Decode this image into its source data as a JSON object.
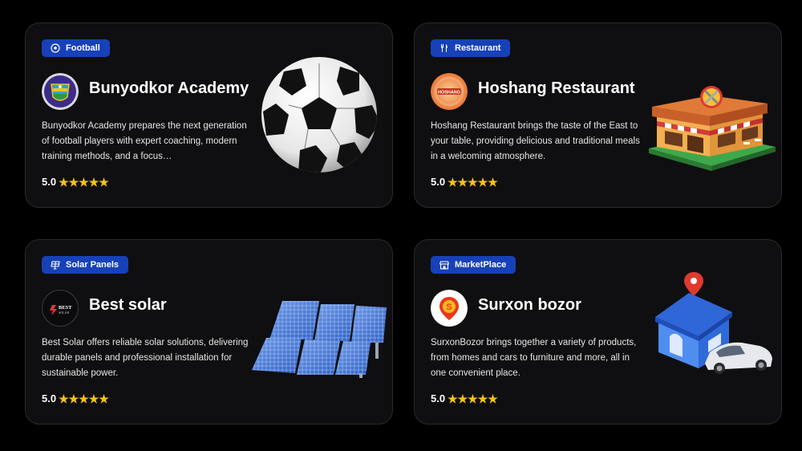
{
  "cards": [
    {
      "category": "Football",
      "category_icon": "soccer-ball-icon",
      "title": "Bunyodkor Academy",
      "description": "Bunyodkor Academy prepares the next generation of football players with expert coaching, modern training methods, and a focus…",
      "rating": "5.0",
      "stars": "★★★★★",
      "illustration": "soccer-ball"
    },
    {
      "category": "Restaurant",
      "category_icon": "fork-knife-icon",
      "title": "Hoshang Restaurant",
      "description": "Hoshang Restaurant brings the taste of the East to your table, providing delicious and traditional meals in a welcoming atmosphere.",
      "rating": "5.0",
      "stars": "★★★★★",
      "illustration": "restaurant-building"
    },
    {
      "category": "Solar Panels",
      "category_icon": "solar-panel-icon",
      "title": "Best solar",
      "logo_text": "BEST SOLAR",
      "description": "Best Solar offers reliable solar solutions, delivering durable panels and professional installation for sustainable power.",
      "rating": "5.0",
      "stars": "★★★★★",
      "illustration": "solar-panels"
    },
    {
      "category": "MarketPlace",
      "category_icon": "storefront-icon",
      "title": "Surxon bozor",
      "description": "SurxonBozor brings together a variety of products, from homes and cars to furniture and more, all in one convenient place.",
      "rating": "5.0",
      "stars": "★★★★★",
      "illustration": "house-and-car"
    }
  ],
  "colors": {
    "background": "#000000",
    "card": "#0f0f11",
    "tag": "#1741b8",
    "star": "#f6c21a"
  }
}
